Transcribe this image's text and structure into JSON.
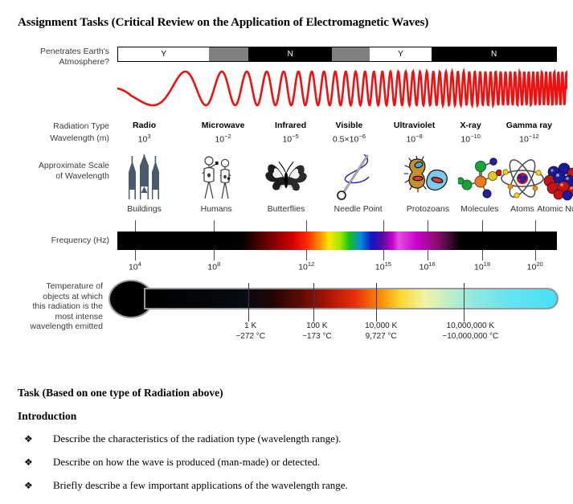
{
  "title": "Assignment Tasks (Critical Review on the Application of Electromagnetic Waves)",
  "row_labels": {
    "atmosphere": "Penetrates Earth's\nAtmosphere?",
    "radiation_type": "Radiation Type",
    "wavelength": "Wavelength (m)",
    "approx_scale": "Approximate Scale\nof Wavelength",
    "frequency": "Frequency (Hz)",
    "temperature": "Temperature of\nobjects at which\nthis radiation is the\nmost intense\nwavelength emitted"
  },
  "atmosphere_segments": [
    {
      "label": "Y",
      "type": "white",
      "width_pct": 20.8
    },
    {
      "label": "",
      "type": "gray",
      "width_pct": 9.0
    },
    {
      "label": "N",
      "type": "black",
      "width_pct": 19.0
    },
    {
      "label": "",
      "type": "gray",
      "width_pct": 8.6
    },
    {
      "label": "Y",
      "type": "white",
      "width_pct": 14.2
    },
    {
      "label": "N",
      "type": "black",
      "width_pct": 28.4
    }
  ],
  "radiation_types": [
    {
      "name": "Radio",
      "wavelength_mantissa": "10",
      "wavelength_exp": "3",
      "center_pct": 6.0,
      "icon": "buildings-icon",
      "scale_label": "Buildings"
    },
    {
      "name": "Microwave",
      "wavelength_mantissa": "10",
      "wavelength_exp": "-2",
      "center_pct": 23.5,
      "icon": "humans-icon",
      "scale_label": "Humans"
    },
    {
      "name": "Infrared",
      "wavelength_mantissa": "10",
      "wavelength_exp": "-5",
      "center_pct": 38.5,
      "icon": "butterfly-icon",
      "scale_label": "Butterflies"
    },
    {
      "name": "Visible",
      "wavelength_mantissa": "0.5×10",
      "wavelength_exp": "-6",
      "center_pct": 51.5,
      "icon": "needle-icon",
      "scale_label": "Needle Point"
    },
    {
      "name": "Ultraviolet",
      "wavelength_mantissa": "10",
      "wavelength_exp": "-8",
      "center_pct": 66.0,
      "icon": "protozoa-icon",
      "scale_label": "Protozoans"
    },
    {
      "name": "X-ray",
      "wavelength_mantissa": "10",
      "wavelength_exp": "-10",
      "center_pct": 78.5,
      "icon": "molecule-icon",
      "scale_label": "Molecules"
    },
    {
      "name": "Gamma ray",
      "wavelength_mantissa": "10",
      "wavelength_exp": "-12",
      "center_pct": 91.5,
      "icon": "atom-icon",
      "scale_label": "Atoms"
    }
  ],
  "scale_labels": [
    {
      "text": "Buildings",
      "center_pct": 6.0
    },
    {
      "text": "Humans",
      "center_pct": 22.0
    },
    {
      "text": "Butterflies",
      "center_pct": 37.5
    },
    {
      "text": "Needle Point",
      "center_pct": 53.5
    },
    {
      "text": "Protozoans",
      "center_pct": 69.0
    },
    {
      "text": "Molecules",
      "center_pct": 80.5
    },
    {
      "text": "Atoms",
      "center_pct": 90.0
    },
    {
      "text": "Atomic Nuclei",
      "center_pct": 99.0
    }
  ],
  "scale_icons": [
    {
      "name": "buildings-icon",
      "center_pct": 6.0
    },
    {
      "name": "humans-icon",
      "center_pct": 22.0
    },
    {
      "name": "butterfly-icon",
      "center_pct": 37.5
    },
    {
      "name": "needle-icon",
      "center_pct": 53.0
    },
    {
      "name": "protozoa-icon",
      "center_pct": 69.0
    },
    {
      "name": "molecule-icon",
      "center_pct": 80.5
    },
    {
      "name": "atom-icon",
      "center_pct": 90.0
    },
    {
      "name": "nucleus-icon",
      "center_pct": 99.0
    }
  ],
  "frequency_ticks": [
    {
      "mantissa": "10",
      "exp": "4",
      "pos_pct": 4.0
    },
    {
      "mantissa": "10",
      "exp": "8",
      "pos_pct": 22.0
    },
    {
      "mantissa": "10",
      "exp": "12",
      "pos_pct": 43.0
    },
    {
      "mantissa": "10",
      "exp": "15",
      "pos_pct": 60.5
    },
    {
      "mantissa": "10",
      "exp": "16",
      "pos_pct": 70.5
    },
    {
      "mantissa": "10",
      "exp": "18",
      "pos_pct": 83.0
    },
    {
      "mantissa": "10",
      "exp": "20",
      "pos_pct": 95.0
    }
  ],
  "temperature_ticks": [
    {
      "kelvin": "1 K",
      "celsius": "−272 °C",
      "pos_pct": 31.0
    },
    {
      "kelvin": "100 K",
      "celsius": "−173 °C",
      "pos_pct": 45.5
    },
    {
      "kelvin": "10,000 K",
      "celsius": "9,727 °C",
      "pos_pct": 59.5
    },
    {
      "kelvin": "10,000,000 K",
      "celsius": "~10,000,000 °C",
      "pos_pct": 79.0
    }
  ],
  "task": {
    "heading": "Task (Based on one type of Radiation above)",
    "subheading": "Introduction",
    "bullet_marker": "❖",
    "bullets": [
      "Describe the characteristics of the radiation type (wavelength range).",
      "Describe on how the wave is produced (man-made) or detected.",
      "Briefly describe a few important applications of the wavelength range."
    ]
  },
  "colors": {
    "wave": "#ee1111",
    "atmosphere_gray": "#808080",
    "bar_black": "#000000",
    "thermo_outline": "#9a9a9a"
  }
}
